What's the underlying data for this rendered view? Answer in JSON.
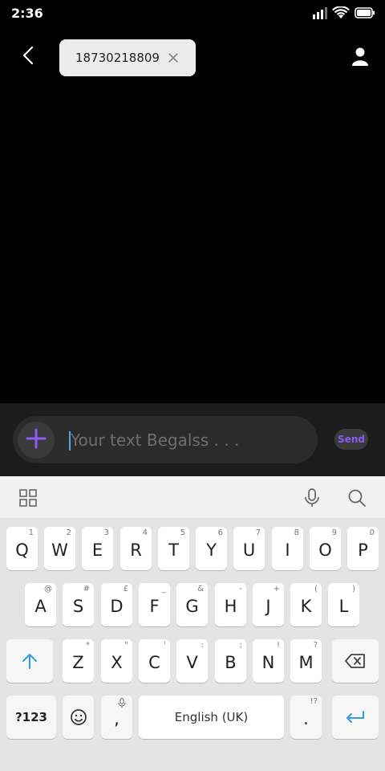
{
  "status": {
    "time": "2:36"
  },
  "header": {
    "recipient": "18730218809"
  },
  "compose": {
    "placeholder": "Your text Begalss . . .",
    "send_label": "Send"
  },
  "keyboard": {
    "row1": [
      {
        "k": "Q",
        "h": "1"
      },
      {
        "k": "W",
        "h": "2"
      },
      {
        "k": "E",
        "h": "3"
      },
      {
        "k": "R",
        "h": "4"
      },
      {
        "k": "T",
        "h": "5"
      },
      {
        "k": "Y",
        "h": "6"
      },
      {
        "k": "U",
        "h": "7"
      },
      {
        "k": "I",
        "h": "8"
      },
      {
        "k": "O",
        "h": "9"
      },
      {
        "k": "P",
        "h": "0"
      }
    ],
    "row2": [
      {
        "k": "A",
        "h": "@"
      },
      {
        "k": "S",
        "h": "#"
      },
      {
        "k": "D",
        "h": "£"
      },
      {
        "k": "F",
        "h": "_"
      },
      {
        "k": "G",
        "h": "&"
      },
      {
        "k": "H",
        "h": "-"
      },
      {
        "k": "J",
        "h": "+"
      },
      {
        "k": "K",
        "h": "("
      },
      {
        "k": "L",
        "h": ")"
      }
    ],
    "row3": [
      {
        "k": "Z",
        "h": "*"
      },
      {
        "k": "X",
        "h": "\""
      },
      {
        "k": "C",
        "h": "'"
      },
      {
        "k": "V",
        "h": ":"
      },
      {
        "k": "B",
        "h": ";"
      },
      {
        "k": "N",
        "h": "!"
      },
      {
        "k": "M",
        "h": "?"
      }
    ],
    "symbols_label": "?123",
    "comma": ",",
    "space_label": "English (UK)",
    "period": ".",
    "period_hint": "!?"
  },
  "colors": {
    "accent": "#8b5cf6",
    "enter": "#2f9be0"
  },
  "icons": [
    "back-icon",
    "close-icon",
    "contact-icon",
    "plus-icon",
    "grid-icon",
    "mic-icon",
    "search-icon",
    "shift-icon",
    "backspace-icon",
    "emoji-icon",
    "enter-icon",
    "signal-icon",
    "wifi-icon",
    "battery-icon"
  ]
}
